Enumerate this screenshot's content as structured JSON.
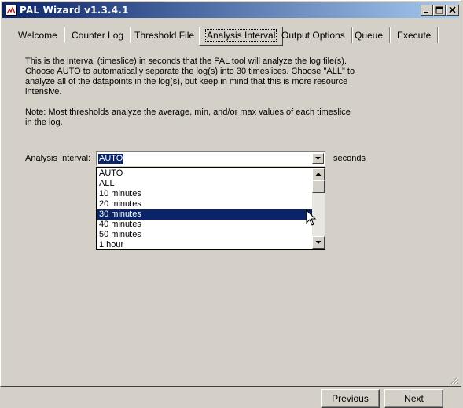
{
  "window": {
    "title": "PAL Wizard v1.3.4.1"
  },
  "tabs": [
    {
      "label": "Welcome"
    },
    {
      "label": "Counter Log"
    },
    {
      "label": "Threshold File"
    },
    {
      "label": "Analysis Interval"
    },
    {
      "label": "Output Options"
    },
    {
      "label": "Queue"
    },
    {
      "label": "Execute"
    }
  ],
  "active_tab": "Analysis Interval",
  "description": "This is the interval (timeslice) in seconds that the PAL tool will analyze the log file(s). Choose AUTO to automatically separate the log(s) into 30 timeslices. Choose \"ALL\" to analyze all of the datapoints in the log(s), but keep in mind that this is more resource intensive.",
  "note": "Note: Most thresholds analyze the average, min, and/or max values of each timeslice in the log.",
  "interval": {
    "label": "Analysis Interval:",
    "value": "AUTO",
    "unit": "seconds",
    "options": [
      "AUTO",
      "ALL",
      "10 minutes",
      "20 minutes",
      "30 minutes",
      "40 minutes",
      "50 minutes",
      "1 hour"
    ],
    "highlighted": "30 minutes"
  },
  "buttons": {
    "previous": "Previous",
    "next": "Next"
  },
  "colors": {
    "titlebar_start": "#0a246a",
    "titlebar_end": "#a6caf0",
    "selection": "#0a246a",
    "face": "#d4d0c8"
  }
}
